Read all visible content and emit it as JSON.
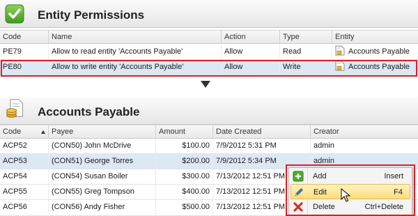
{
  "permissions_panel": {
    "title": "Entity Permissions",
    "columns": [
      "Code",
      "Name",
      "Action",
      "Type",
      "Entity"
    ],
    "rows": [
      {
        "code": "PE79",
        "name": "Allow to read entity 'Accounts Payable'",
        "action": "Allow",
        "type": "Read",
        "entity": "Accounts Payable"
      },
      {
        "code": "PE80",
        "name": "Allow to write entity 'Accounts Payable'",
        "action": "Allow",
        "type": "Write",
        "entity": "Accounts Payable"
      }
    ]
  },
  "payable_panel": {
    "title": "Accounts Payable",
    "columns": [
      "Code",
      "Payee",
      "Amount",
      "Date Created",
      "Creator"
    ],
    "rows": [
      {
        "code": "ACP52",
        "payee": "(CON50) John McDrive",
        "amount": "$100.00",
        "date": "7/9/2012 5:31 PM",
        "creator": "admin"
      },
      {
        "code": "ACP53",
        "payee": "(CON51) George Torres",
        "amount": "$200.00",
        "date": "7/9/2012 5:34 PM",
        "creator": "admin"
      },
      {
        "code": "ACP54",
        "payee": "(CON54) Susan Boiler",
        "amount": "$300.00",
        "date": "7/13/2012 12:51 PM",
        "creator": "admin"
      },
      {
        "code": "ACP55",
        "payee": "(CON55) Greg Tompson",
        "amount": "$400.00",
        "date": "7/13/2012 12:51 PM",
        "creator": "admin"
      },
      {
        "code": "ACP56",
        "payee": "(CON56) Andy Fisher",
        "amount": "$500.00",
        "date": "7/13/2012 12:51 PM",
        "creator": "admin"
      }
    ]
  },
  "context_menu": {
    "items": [
      {
        "label": "Add",
        "shortcut": "Insert",
        "icon": "add-icon"
      },
      {
        "label": "Edit",
        "shortcut": "F4",
        "icon": "pencil-icon"
      },
      {
        "label": "Delete",
        "shortcut": "Ctrl+Delete",
        "icon": "delete-icon"
      }
    ]
  },
  "colors": {
    "highlight_frame": "#d9202a",
    "selected_row": "#dde8f5",
    "menu_hover": "#fbdd7d"
  }
}
